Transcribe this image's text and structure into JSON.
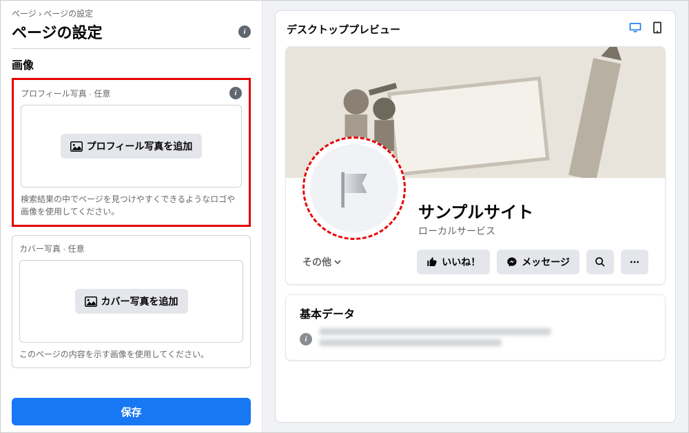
{
  "breadcrumb": "ページ › ページの設定",
  "page_title": "ページの設定",
  "section_label": "画像",
  "profile": {
    "label": "プロフィール写真 · 任意",
    "button": "プロフィール写真を追加",
    "helper": "検索結果の中でページを見つけやすくできるようなロゴや画像を使用してください。"
  },
  "cover": {
    "label": "カバー写真 · 任意",
    "button": "カバー写真を追加",
    "helper": "このページの内容を示す画像を使用してください。"
  },
  "save_label": "保存",
  "preview": {
    "head": "デスクトッププレビュー",
    "page_name": "サンプルサイト",
    "category": "ローカルサービス",
    "tab_other": "その他",
    "like_btn": "いいね！",
    "message_btn": "メッセージ",
    "basic_title": "基本データ"
  }
}
